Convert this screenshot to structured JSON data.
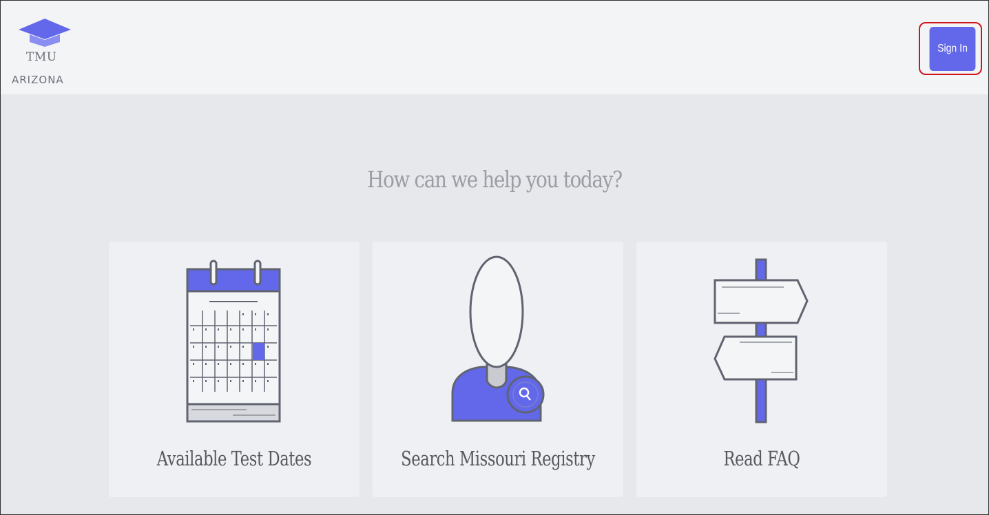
{
  "brand": {
    "abbr": "TMU",
    "state": "ARIZONA"
  },
  "header": {
    "sign_in_label": "Sign In"
  },
  "main": {
    "headline": "How can we help you today?",
    "cards": [
      {
        "label": "Available Test Dates",
        "icon": "calendar-icon"
      },
      {
        "label": "Search Missouri Registry",
        "icon": "person-search-icon"
      },
      {
        "label": "Read FAQ",
        "icon": "signpost-icon"
      }
    ]
  },
  "colors": {
    "accent": "#6368ea",
    "highlight": "#d0151a",
    "header_bg": "#f3f4f6",
    "page_bg": "#e6e8ec"
  }
}
